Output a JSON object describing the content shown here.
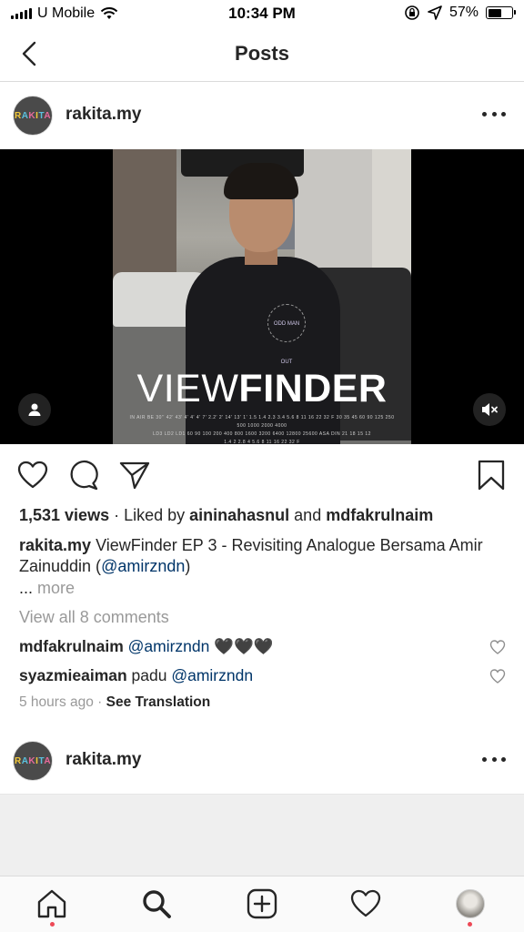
{
  "status_bar": {
    "carrier": "U Mobile",
    "time": "10:34 PM",
    "battery_percent": "57%",
    "battery_level": 0.57
  },
  "nav": {
    "title": "Posts",
    "back_icon": "chevron-left-icon"
  },
  "post": {
    "username": "rakita.my",
    "avatar_text": "RAKITA",
    "media": {
      "title_light": "VIEW",
      "title_bold": "FINDER",
      "shirt_text": "ODD MAN OUT",
      "credits_line1": "IN AIR BE 30'' 42' 43' 4' 4' 4' 7' 2.2' 2' 14' 13' 1' 1.5 1.4 2.3 3.4 5.6 8 11 16 22 32 F 30 35 45 60 90 125 250 500 1000 2000 4000",
      "credits_line2": "LD3 LD2 LD1 60 90 100 200 400 800 1600 3200 6400 12800 25600 ASA DIN 21 18 15 12",
      "credits_line3": "1.4 2 2.8 4 5.6 8 11 16 22 32 F"
    },
    "views": "1,531 views",
    "liked_by_prefix": " · Liked by ",
    "liked_by_user1": "aininahasnul",
    "liked_by_and": " and ",
    "liked_by_user2": "mdfakrulnaim",
    "caption_user": "rakita.my",
    "caption_text": " ViewFinder EP 3 - Revisiting Analogue Bersama Amir Zainuddin (",
    "caption_mention": "@amirzndn",
    "caption_close": ")",
    "more_prefix": "... ",
    "more": "more",
    "view_all_comments": "View all 8 comments",
    "comments": [
      {
        "user": "mdfakrulnaim",
        "mention": "@amirzndn",
        "text": " 🖤🖤🖤"
      },
      {
        "user": "syazmieaiman",
        "text": " padu ",
        "mention": "@amirzndn"
      }
    ],
    "time_ago": "5 hours ago",
    "time_sep": " · ",
    "see_translation": "See Translation"
  },
  "next_post": {
    "username": "rakita.my",
    "avatar_text": "RAKITA"
  },
  "tabs": [
    "home-icon",
    "search-icon",
    "add-post-icon",
    "activity-heart-icon",
    "profile-avatar"
  ]
}
